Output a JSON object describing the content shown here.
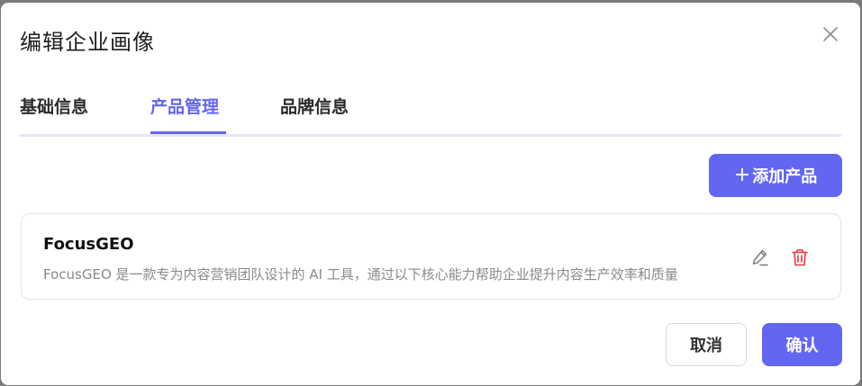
{
  "dialog": {
    "title": "编辑企业画像",
    "close_icon": "close-icon"
  },
  "tabs": [
    {
      "label": "基础信息",
      "active": false
    },
    {
      "label": "产品管理",
      "active": true
    },
    {
      "label": "品牌信息",
      "active": false
    }
  ],
  "toolbar": {
    "add_plus": "+",
    "add_label": "添加产品"
  },
  "products": [
    {
      "name": "FocusGEO",
      "description": "FocusGEO 是一款专为内容营销团队设计的 AI 工具，通过以下核心能力帮助企业提升内容生产效率和质量",
      "edit_icon": "pencil-icon",
      "delete_icon": "trash-icon"
    }
  ],
  "footer": {
    "cancel_label": "取消",
    "confirm_label": "确认"
  },
  "colors": {
    "accent": "#6366f1",
    "delete": "#e53935",
    "tab_divider": "#e6e4f5"
  }
}
